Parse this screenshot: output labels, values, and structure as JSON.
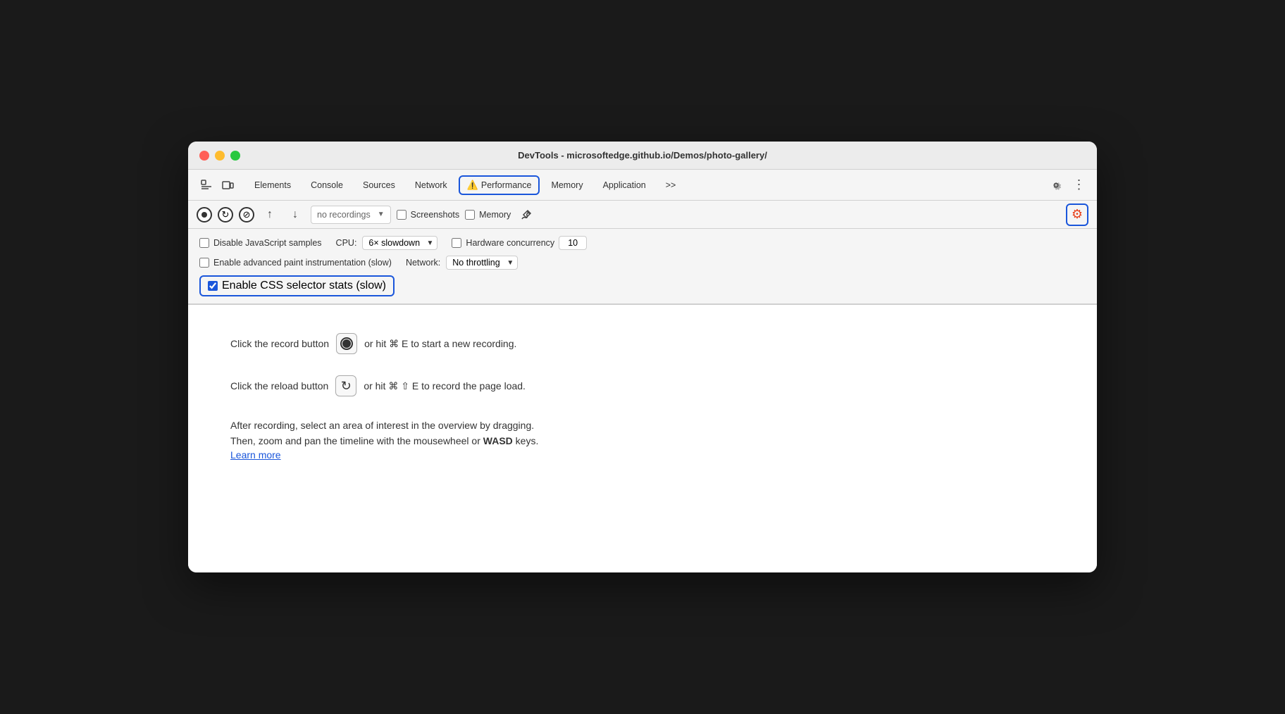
{
  "window": {
    "title": "DevTools - microsoftedge.github.io/Demos/photo-gallery/"
  },
  "tabs": {
    "items": [
      {
        "id": "elements",
        "label": "Elements",
        "active": false
      },
      {
        "id": "console",
        "label": "Console",
        "active": false
      },
      {
        "id": "sources",
        "label": "Sources",
        "active": false
      },
      {
        "id": "network",
        "label": "Network",
        "active": false
      },
      {
        "id": "performance",
        "label": "Performance",
        "active": true,
        "hasWarning": true
      },
      {
        "id": "memory",
        "label": "Memory",
        "active": false
      },
      {
        "id": "application",
        "label": "Application",
        "active": false
      }
    ],
    "overflow": ">>"
  },
  "secondary_toolbar": {
    "recording_placeholder": "no recordings",
    "screenshots_label": "Screenshots",
    "memory_label": "Memory"
  },
  "settings": {
    "disable_js_samples": {
      "label": "Disable JavaScript samples",
      "checked": false
    },
    "cpu_label": "CPU:",
    "cpu_value": "6× slowdown",
    "hardware_concurrency": {
      "label": "Hardware concurrency",
      "checked": false,
      "value": "10"
    },
    "enable_paint": {
      "label": "Enable advanced paint instrumentation (slow)",
      "checked": false
    },
    "network_label": "Network:",
    "network_value": "No throttling",
    "css_selector": {
      "label": "Enable CSS selector stats (slow)",
      "checked": true
    }
  },
  "main_content": {
    "record_instruction": "Click the record button",
    "record_suffix": "or hit ⌘ E to start a new recording.",
    "reload_instruction": "Click the reload button",
    "reload_suffix": "or hit ⌘ ⇧ E to record the page load.",
    "description_line1": "After recording, select an area of interest in the overview by dragging.",
    "description_line2": "Then, zoom and pan the timeline with the mousewheel or",
    "description_wasd": "WASD",
    "description_keys_suffix": "keys.",
    "learn_more": "Learn more"
  }
}
